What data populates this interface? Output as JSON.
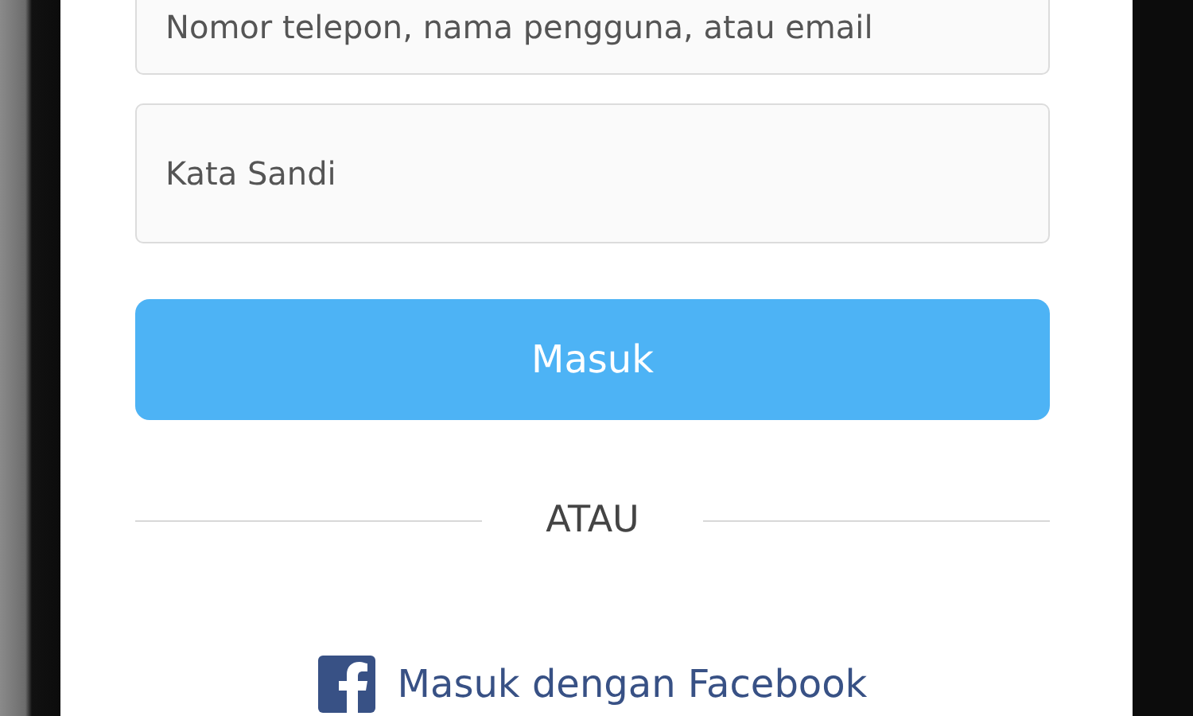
{
  "login_form": {
    "username": {
      "placeholder": "Nomor telepon, nama pengguna, atau email"
    },
    "password": {
      "placeholder": "Kata Sandi"
    },
    "login_button": "Masuk",
    "divider": "ATAU",
    "facebook_link": "Masuk dengan Facebook"
  }
}
